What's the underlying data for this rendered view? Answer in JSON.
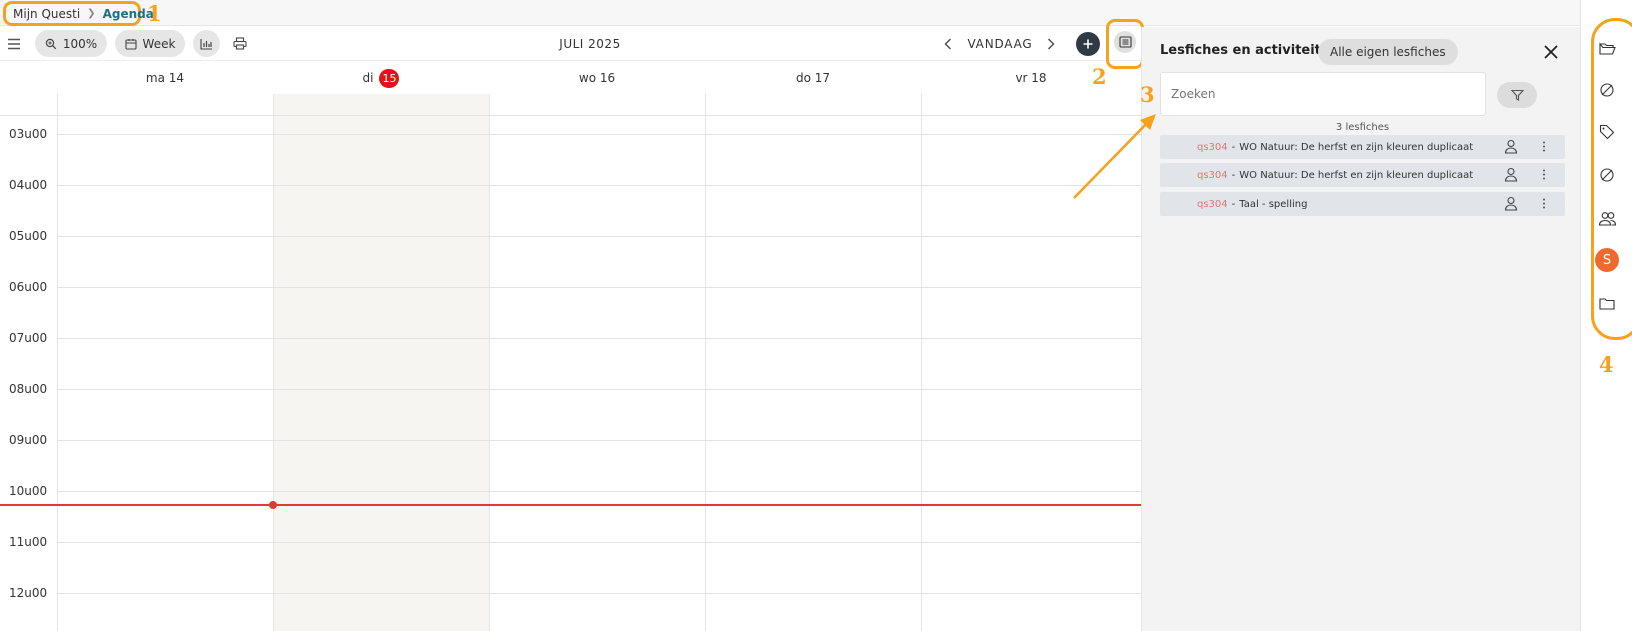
{
  "breadcrumb": {
    "home": "Mijn Questi",
    "current": "Agenda"
  },
  "annotations": {
    "n1": "1",
    "n2": "2",
    "n3": "3",
    "n4": "4"
  },
  "toolbar": {
    "zoom": "100%",
    "view": "Week",
    "month": "JULI 2025",
    "today": "VANDAAG"
  },
  "days": [
    {
      "label": "ma 14"
    },
    {
      "label": "di",
      "badge": "15"
    },
    {
      "label": "wo 16"
    },
    {
      "label": "do 17"
    },
    {
      "label": "vr 18"
    }
  ],
  "hours": [
    "03u00",
    "04u00",
    "05u00",
    "06u00",
    "07u00",
    "08u00",
    "09u00",
    "10u00",
    "11u00",
    "12u00"
  ],
  "panel": {
    "title": "Lesfiches en activiteiten",
    "chip": "Alle eigen lesfiches",
    "search_placeholder": "Zoeken",
    "count": "3 lesfiches",
    "items": [
      {
        "code": "qs304",
        "title": "WO Natuur: De herfst en zijn kleuren duplicaat"
      },
      {
        "code": "qs304",
        "title": "WO Natuur: De herfst en zijn kleuren duplicaat"
      },
      {
        "code": "qs304",
        "title": "Taal - spelling"
      }
    ]
  },
  "rail": {
    "icons": [
      "folder-open-icon",
      "no-entry-icon",
      "tag-icon",
      "no-entry-icon",
      "group-icon",
      "user-avatar",
      "folder-icon"
    ],
    "avatar_letter": "S"
  },
  "colors": {
    "accent_annotation": "#f7a21b",
    "today_badge": "#e4131b",
    "now_line": "#e23b2e",
    "code": "#d9786f",
    "avatar": "#ef6a2c"
  }
}
